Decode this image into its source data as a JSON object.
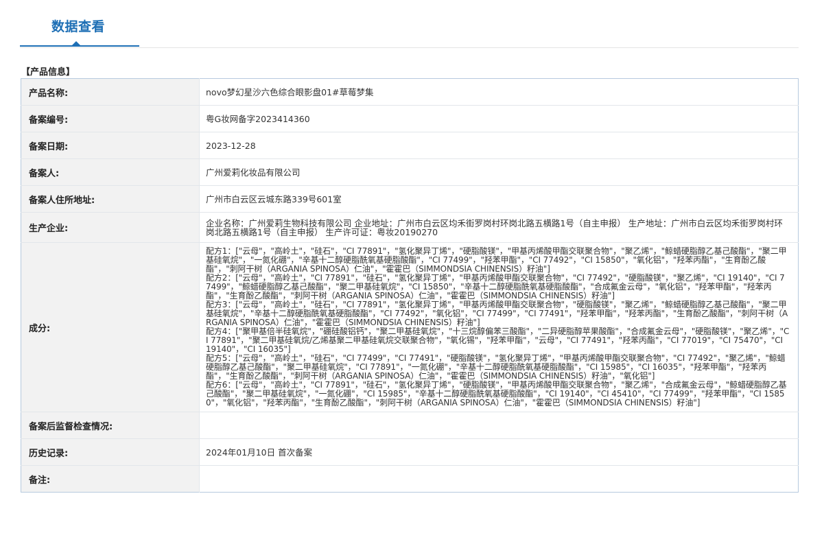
{
  "tab": {
    "title": "数据查看"
  },
  "section": {
    "title": "【产品信息】"
  },
  "rows": [
    {
      "label": "产品名称:",
      "value": "novo梦幻星沙六色综合眼影盘01#草莓梦集"
    },
    {
      "label": "备案编号:",
      "value": "粤G妆网备字2023414360"
    },
    {
      "label": "备案日期:",
      "value": "2023-12-28"
    },
    {
      "label": "备案人:",
      "value": "广州爱莉化妆品有限公司"
    },
    {
      "label": "备案人住所地址:",
      "value": "广州市白云区云城东路339号601室"
    },
    {
      "label": "生产企业:",
      "value": "企业名称：广州爱莉生物科技有限公司 企业地址：广州市白云区均禾街罗岗村环岗北路五横路1号（自主申报） 生产地址：广州市白云区均禾街罗岗村环岗北路五横路1号（自主申报） 生产许可证：粤妆20190270"
    },
    {
      "label": "成分:"
    },
    {
      "label": "备案后监督检查情况:",
      "value": ""
    },
    {
      "label": "历史记录:",
      "value": "2024年01月10日 首次备案"
    },
    {
      "label": "备注:",
      "value": ""
    }
  ],
  "ingredients": [
    "配方1：[\"云母\"，\"高岭土\"，\"硅石\"，\"CI 77891\"，\"氢化聚异丁烯\"，\"硬脂酸镁\"，\"甲基丙烯酸甲酯交联聚合物\"，\"聚乙烯\"，\"鲸蜡硬脂醇乙基己酸酯\"，\"聚二甲基硅氧烷\"，\"一氮化硼\"，\"辛基十二醇硬脂酰氧基硬脂酸酯\"，\"CI 77499\"，\"羟苯甲酯\"，\"CI 77492\"，\"CI 15850\"，\"氧化铝\"，\"羟苯丙酯\"，\"生育酚乙酸酯\"，\"刺阿干树（ARGANIA SPINOSA）仁油\"，\"霍霍巴（SIMMONDSIA CHINENSIS）籽油\"]",
    "配方2：[\"云母\"，\"高岭土\"，\"CI 77891\"，\"硅石\"，\"氢化聚异丁烯\"，\"甲基丙烯酸甲酯交联聚合物\"，\"CI 77492\"，\"硬脂酸镁\"，\"聚乙烯\"，\"CI 19140\"，\"CI 77499\"，\"鲸蜡硬脂醇乙基己酸酯\"，\"聚二甲基硅氧烷\"，\"CI 15850\"，\"辛基十二醇硬脂酰氧基硬脂酸酯\"，\"合成氟金云母\"，\"氧化铝\"，\"羟苯甲酯\"，\"羟苯丙酯\"，\"生育酚乙酸酯\"，\"刺阿干树（ARGANIA SPINOSA）仁油\"，\"霍霍巴（SIMMONDSIA CHINENSIS）籽油\"]",
    "配方3：[\"云母\"，\"高岭土\"，\"硅石\"，\"CI 77891\"，\"氢化聚异丁烯\"，\"甲基丙烯酸甲酯交联聚合物\"，\"硬脂酸镁\"，\"聚乙烯\"，\"鲸蜡硬脂醇乙基己酸酯\"，\"聚二甲基硅氧烷\"，\"辛基十二醇硬脂酰氧基硬脂酸酯\"，\"CI 77492\"，\"氧化铝\"，\"CI 77499\"，\"CI 77491\"，\"羟苯甲酯\"，\"羟苯丙酯\"，\"生育酚乙酸酯\"，\"刺阿干树（ARGANIA SPINOSA）仁油\"，\"霍霍巴（SIMMONDSIA CHINENSIS）籽油\"]",
    "配方4：[\"聚甲基倍半硅氧烷\"，\"硼硅酸铝钙\"，\"聚二甲基硅氧烷\"，\"十三烷醇偏苯三酸酯\"，\"二异硬脂醇苹果酸酯\"，\"合成氟金云母\"，\"硬脂酸镁\"，\"聚乙烯\"，\"CI 77891\"，\"聚二甲基硅氧烷/乙烯基聚二甲基硅氧烷交联聚合物\"，\"氧化锡\"，\"羟苯甲酯\"，\"云母\"，\"CI 77491\"，\"羟苯丙酯\"，\"CI 77019\"，\"CI 75470\"，\"CI 19140\"，\"CI 16035\"]",
    "配方5：[\"云母\"，\"高岭土\"，\"硅石\"，\"CI 77499\"，\"CI 77491\"，\"硬脂酸镁\"，\"氢化聚异丁烯\"，\"甲基丙烯酸甲酯交联聚合物\"，\"CI 77492\"，\"聚乙烯\"，\"鲸蜡硬脂醇乙基己酸酯\"，\"聚二甲基硅氧烷\"，\"CI 77891\"，\"一氮化硼\"，\"辛基十二醇硬脂酰氧基硬脂酸酯\"，\"CI 15985\"，\"CI 16035\"，\"羟苯甲酯\"，\"羟苯丙酯\"，\"生育酚乙酸酯\"，\"刺阿干树（ARGANIA SPINOSA）仁油\"，\"霍霍巴（SIMMONDSIA CHINENSIS）籽油\"，\"氧化铝\"]",
    "配方6：[\"云母\"，\"高岭土\"，\"CI 77891\"，\"硅石\"，\"氢化聚异丁烯\"，\"硬脂酸镁\"，\"甲基丙烯酸甲酯交联聚合物\"，\"聚乙烯\"，\"合成氟金云母\"，\"鲸蜡硬脂醇乙基己酸酯\"，\"聚二甲基硅氧烷\"，\"一氮化硼\"，\"CI 15985\"，\"辛基十二醇硬脂酰氧基硬脂酸酯\"，\"CI 19140\"，\"CI 45410\"，\"CI 77499\"，\"羟苯甲酯\"，\"CI 15850\"，\"氧化铝\"，\"羟苯丙酯\"，\"生育酚乙酸酯\"，\"刺阿干树（ARGANIA SPINOSA）仁油\"，\"霍霍巴（SIMMONDSIA CHINENSIS）籽油\"]"
  ],
  "colors": {
    "accent": "#1e6fb5",
    "label_bg": "#f2f2f2",
    "table_border": "#b6c9de"
  }
}
